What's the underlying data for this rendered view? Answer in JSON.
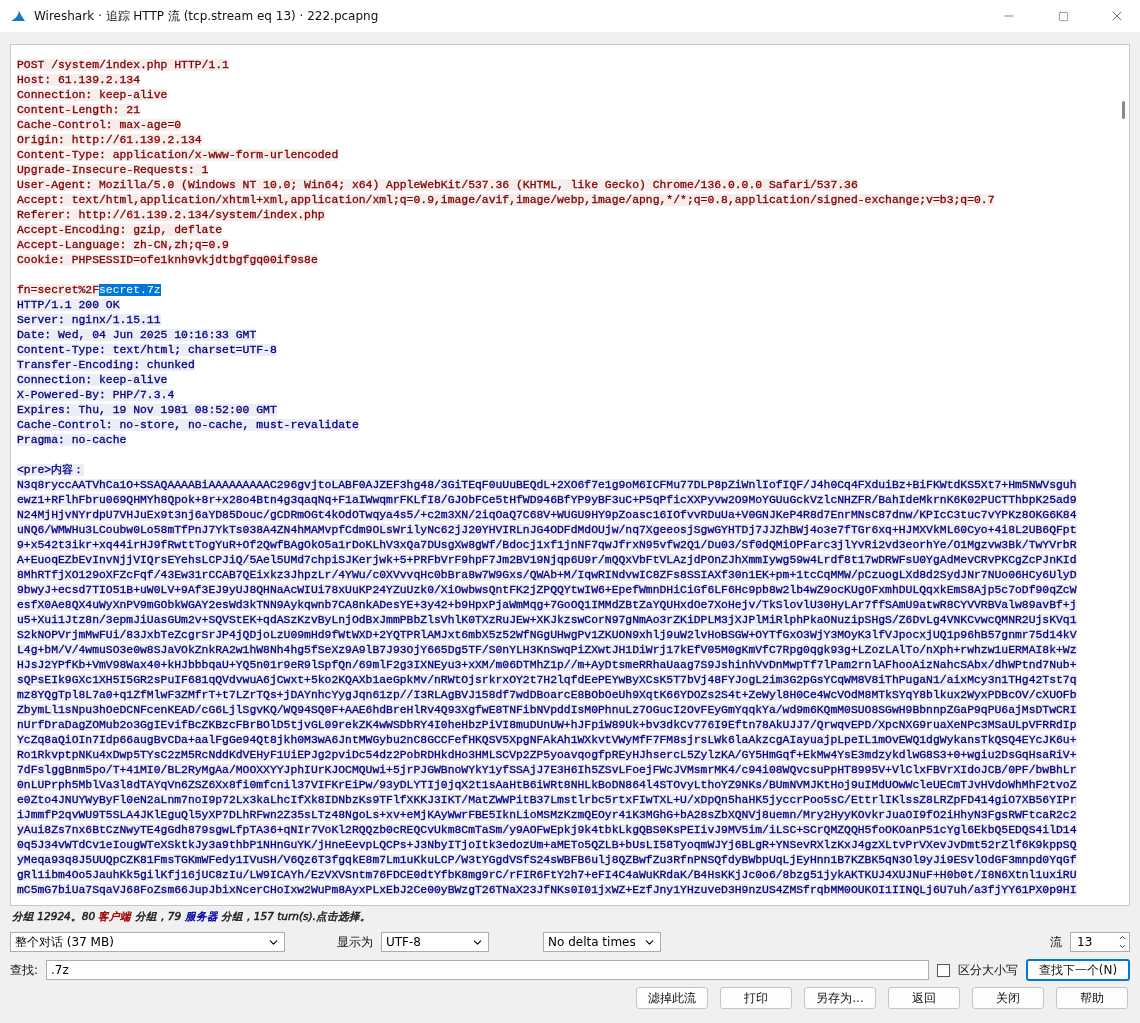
{
  "window": {
    "title": "Wireshark · 追踪 HTTP 流 (tcp.stream eq 13) · 222.pcapng"
  },
  "stream": [
    {
      "color": "#7f0000",
      "kind": "headers",
      "lines": [
        "POST /system/index.php HTTP/1.1",
        "Host: 61.139.2.134",
        "Connection: keep-alive",
        "Content-Length: 21",
        "Cache-Control: max-age=0",
        "Origin: http://61.139.2.134",
        "Content-Type: application/x-www-form-urlencoded",
        "Upgrade-Insecure-Requests: 1",
        "User-Agent: Mozilla/5.0 (Windows NT 10.0; Win64; x64) AppleWebKit/537.36 (KHTML, like Gecko) Chrome/136.0.0.0 Safari/537.36",
        "Accept: text/html,application/xhtml+xml,application/xml;q=0.9,image/avif,image/webp,image/apng,*/*;q=0.8,application/signed-exchange;v=b3;q=0.7",
        "Referer: http://61.139.2.134/system/index.php",
        "Accept-Encoding: gzip, deflate",
        "Accept-Language: zh-CN,zh;q=0.9",
        "Cookie: PHPSESSID=ofe1knh9vkjdtbgfgq00if9s8e"
      ]
    },
    {
      "color": "#7f0000",
      "kind": "body",
      "lines": [
        {
          "parts": [
            {
              "text": "fn=secret%2F",
              "selected": false
            },
            {
              "text": "secret.7z",
              "selected": true
            }
          ]
        }
      ]
    },
    {
      "color": "#00007f",
      "kind": "headers",
      "lines": [
        "HTTP/1.1 200 OK",
        "Server: nginx/1.15.11",
        "Date: Wed, 04 Jun 2025 10:16:33 GMT",
        "Content-Type: text/html; charset=UTF-8",
        "Transfer-Encoding: chunked",
        "Connection: keep-alive",
        "X-Powered-By: PHP/7.3.4",
        "Expires: Thu, 19 Nov 1981 08:52:00 GMT",
        "Cache-Control: no-store, no-cache, must-revalidate",
        "Pragma: no-cache"
      ]
    },
    {
      "color": "#00007f",
      "kind": "body",
      "lines": [
        "<pre>内容：",
        "N3q8ryccAATVhCa1O+SSAQAAAABiAAAAAAAAAC296gvjtoLABF0AJZEF3hg48/3GiTEqF0uUuBEQdL+2XO6f7e1g9oM6ICFMu77DLP8pZiWnlIofIQF/J4h0Cq4FXduiBz+BiFKWtdKS5Xt7+Hm5NWVsguh",
        "ewz1+RFlhFbru069QHMYh8Qpok+8r+x28o4Btn4g3qaqNq+F1aIWwqmrFKLfI8/GJObFCe5tHfWD946BfYP9yBF3uC+P5qPficXXPyvw2O9MoYGUuGckVzlcNHZFR/BahIdeMkrnK6K02PUCTThbpK25ad9",
        "N24MjHjvNYrdpU7VHJuEx9t3nj6aYD85Douc/gCDRmOGt4kOdOTwqya4s5/+c2m3XN/2iqOaQ7C68V+WUGU9HY9pZoasc16IOfvvRDuUa+V0GNJKeP4R8d7EnrMNsC87dnw/KPIcC3tuc7vYPKz8OKG6K84",
        "uNQ6/WMWHu3LCoubw0Lo58mTfPnJ7YkTs038A4ZN4hMAMvpfCdm9OLsWrilyNc62jJ20YHVIRLnJG4ODFdMdOUjw/nq7XgeeosjSgwGYHTDj7JJZhBWj4o3e7fTGr6xq+HJMXVkML60Cyo+4i8L2UB6QFpt",
        "9+x542t3ikr+xq44irHJ9fRwttTogYuR+Of2QwfBAgOkO5a1rDoKLhV3xQa7DUsgXw8gWf/Bdocj1xf1jnNF7qwJfrxN95vfw2Q1/Du03/Sf0dQMiOPFarc3jlYvRi2vd3eorhYe/O1Mgzvw3Bk/TwYVrbR",
        "A+EuoqEZbEvInvNjjVIQrsEYehsLCPJiQ/5Ael5UMd7chpiSJKerjwk+5+PRFbVrF9hpF7Jm2BV19Njqp6U9r/mQQxVbFtVLAzjdPOnZJhXmmIywg59w4Lrdf8t17wDRWFsU0YgAdMevCRvPKCgZcPJnKId",
        "8MhRTfjXO129oXFZcFqf/43Ew31rCCAB7QEixkz3JhpzLr/4YWu/c0XVvvqHc0bBra8w7W9Gxs/QWAb+M/IqwRINdvwIC8ZFs8SSIAXf30n1EK+pm+1tcCqMMW/pCzuogLXd8d2SydJNr7NUo06HCy6UlyD",
        "9bwyJ+ecsd7TIO51B+uW0LV+9Af3EJ9yUJ8QHNaAcWIUi78xUuKP24YZuUzk0/XiOwbwsQntFK2jZPQQYtwIW6+EpefWmnDHiCiGf6LF6Hc9pb8w2lb4wZ9ocKUgOFxmhDULQqxkEmS8Ajp5c7oDf90qZcW",
        "esfX0Ae8QX4uWyXnPV9mGObkWGAY2esWd3kTNN9Aykqwnb7CA8nkADesYE+3y42+b9HpxPjaWmMqg+7GoOQ1IMMdZBtZaYQUHxdOe7XoHejv/TkSlovlU30HyLAr7ffSAmU9atwR8CYVVRBValw89avBf+j",
        "u5+Xui1Jtz8n/3epmJiUasGUm2v+SQVStEK+qdASzKzvByLnjOdBxJmmPBbZlsVhlK0TXzRuJEw+XKJkzswCorN97gNmAo3rZKiDPLM3jXJPlMiRlphPkaONuzipSHgS/Z6DvLg4VNKCvwcQMNR2UjsKVq1",
        "S2kNOPVrjmMwFUi/83JxbTeZcgrSrJP4jQDjoLzU09mHd9fWtWXD+2YQTPRlAMJxt6mbX5z52WfNGgUHwgPv1ZKUON9xhlj9uW2lvHoBSGW+OYTfGxO3WjY3MOyK3lfVJpocxjUQ1p96hB57gnmr75d14kV",
        "L4g+bM/V/4wmuSO3e0w8SJaVOkZnkRA2w1hW8Nh4hg5fSeXz9A9lB7J93OjY665Dg5TF/S0nYLH3KnSwqPiZXwtJH1DiWrj17kEfV05M0gKmVfC7Rpg0qgk93g+LZozLAlTo/nXph+rwhzw1uERMAI8k+Wz",
        "HJsJ2YPfKb+VmV98Wax40+kHJbbbqaU+YQ5n01r9eR9lSpfQn/69mlF2g3IXNEyu3+xXM/m06DTMhZ1p//m+AyDtsmeRRhaUaag7S9JshinhVvDnMwpTf7lPam2rnlAFhooAizNahcSAbx/dhWPtnd7Nub+",
        "sQPsEIk9GXc1XH5I5GR2sPuIF681qQVdvwuA6jCwxt+5ko2KQAXb1aeGpkMv/nRWtOjsrkrxOY2t7H2lqfdEePEYwByXCsK5T7bVj48FYJogL2im3G2pGsYCqWM8V8iThPugaN1/aixMcy3n1THg42Tst7q",
        "mz8YQgTpl8L7a0+q1ZfMlwF3ZMfrT+t7LZrTQs+jDAYnhcYygJqn61zp//I3RLAgBVJ158df7wdDBoarcE8BObOeUh9XqtK66YDOZs2S4t+ZeWyl8H0Ce4WcVOdM8MTkSYqY8blkux2WyxPDBcOV/cXUOFb",
        "ZbymLl1sNpu3hOeDCNFcenKEAD/cG6LjlSgvKQ/WQ94SQ0F+AAE6hdBreHlRv4Q93XgfwE8TNFibNVpddIsM0PhnuLz7OGucI2OvFEyGmYqqkYa/wd9m6KQmM0SUO8SGwH9BbnnpZGaP9qPU6ajMsDTwCRI",
        "nUrfDraDagZOMub2o3GgIEvifBcZKBzcFBrBOlD5tjvGL09rekZK4wWSDbRY4I0heHbzPiVI8muDUnUW+hJFpiW89Uk+bv3dkCv776I9Eftn78AkUJJ7/QrwqvEPD/XpcNXG9ruaXeNPc3MSaULpVFRRdIp",
        "YcZq8aQiOIn7Idp66augBvCDa+aalFgGe94Qt8jkh0M3wA6JntMWGybu2nC8GCCFefHKQSV5XpgNFAkAh1WXkvtVWyMfF7FM8sjrsLWk6laAkzcgAIayuajpLpeIL1mOvEWQ1dgWykansTkQSQ4EYcJK6u+",
        "Ro1RkvptpNKu4xDwp5TYsC2zM5RcNddKdVEHyF1UiEPJg2pviDc54dz2PobRDHkdHo3HMLSCVp2ZP5yoavqogfpREyHJhsercL5ZylzKA/GY5HmGqf+EkMw4YsE3mdzykdlwG8S3+0+wgiu2DsGqHsaRiV+",
        "7dFslggBnm5po/T+41MI0/BL2RyMgAa/MOOXXYYJphIUrKJOCMQUwi+5jrPJGWBnoWYkY1yfSSAjJ7E3H6Ih5ZSvLFoejFWcJVMsmrMK4/c94i08WQvcsuPpHT8995V+VlClxFBVrXIdoJCB/0PF/bwBhLr",
        "0nLUPrph5MblVa3l8dTAYqVn6ZSZ6Xx8fi0mfcnil37VIFKrEiPw/93yDLYTIj0jqX2t1sAaHtB6iWRt8NHLkBoDN864l4STOvyLthoYZ9NKs/BUmNVMJKtHoj9uIMdUOwWcleUECmTJvHVdoWhMhF2tvoZ",
        "e0Zto4JNUYWyByFl0eN2aLnm7noI9p72Lx3kaLhcIfXk8IDNbzKs9TFlfXKKJ3IKT/MatZWWPitB37Lmstlrbc5rtxFIwTXL+U/xDpQn5haHK5jyccrPoo5sC/EttrlIKlssZ8LRZpFD414giO7XB56YIPr",
        "iJmmfP2qvWU9T5SLA4JKlEguQl5yXP7DLhRFwn2Z35sLTz48NgoLs+xv+eMjKAyWwrFBE5IknLioMSMzKzmQEOyr41K3MGhG+bA28sZbXQNVj8uemn/Mry2HyyKOvkrJuaOI9fO2iHhyN3FgsRWFtcaR2c2",
        "yAui8Zs7nx6BtCzNwyTE4gGdh879sgwLfpTA36+qNIr7VoKl2RQQzb0cREQCvUkm8CmTaSm/y9AOFwEpkj9k4tbkLkgQBS0KsPEIivJ9MV5im/iLSC+SCrQMZQQH5foOKOanP51cYgl6EkbQ5EDQS4ilD14",
        "0q5J34vWTdCv1eIougWTeXSktkJy3a9thbP1NHnGuYK/jHneEevpLQCPs+J3NbyITjoItk3edozUm+aMETo5QZLB+bUsLI58TyoqmWJYj6BLgR+YNSevRXlzKxJ4gzXLtvPrVXevJvDmt52rZlf6K9kppSQ",
        "yMeqa93q8J5UUQpCZK81FmsTGKmWFedy1IVuSH/V6Qz6T3fgqkE8m7Lm1uKkuLCP/W3tYGgdVSfS24sWBFB6ulj8QZBwfZu3RfnPNSQfdyBWbpUqLjEyHnn1B7KZBK5qN3Ol9yJi9ESvlOdGF3mnpd0YqGf",
        "gRl1ibm4Oo5JauhKk5gilKfj16jUC8zIu/LW9ICAYh/EzVXVSntm76FDCE0dtYfbK8mg9rC/rFIR6FtY2h7+eFI4C4aWuKRdaK/B4HsKKjJc0o6/8bzg51jykAKTKUJ4XUJNuF+H0b0t/I8N6Xtnl1uxiRU",
        "mC5mG7biUa7SqaVJ68FoZsm66JupJbixNcerCHoIxw2WuPm8AyxPLxEbJ2Ce00yBWzgT26TNaX23JfNKs0I01jxWZ+EzfJny1YHzuveD3H9nzUS4ZMSfrqbMM0OUKOI1IINQLj6U7uh/a3fjYY61PX0p9HI"
      ]
    }
  ],
  "status": {
    "parts": [
      {
        "text": "分组 12924。80 ",
        "color": "#222222"
      },
      {
        "text": "客户端",
        "color": "#a00000"
      },
      {
        "text": " 分组，79 ",
        "color": "#222222"
      },
      {
        "text": "服务器",
        "color": "#0000a0"
      },
      {
        "text": " 分组，157 turn(s).点击选择。",
        "color": "#222222"
      }
    ]
  },
  "controls": {
    "conversation": "整个对话 (37 MB)",
    "show_as_label": "显示为",
    "encoding": "UTF-8",
    "delta": "No delta times",
    "stream_label": "流",
    "stream": "13"
  },
  "find": {
    "label": "查找:",
    "value": ".7z",
    "case_sensitive": {
      "label": "区分大小写",
      "checked": false
    },
    "next_button": {
      "label": "查找下一个(N)",
      "default": true
    }
  },
  "buttons": [
    "滤掉此流",
    "打印",
    "另存为...",
    "返回",
    "关闭",
    "帮助"
  ]
}
